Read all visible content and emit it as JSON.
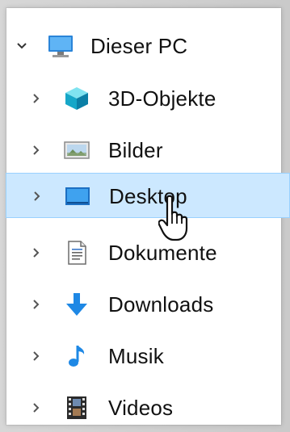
{
  "tree": {
    "root": {
      "label": "Dieser PC",
      "icon": "this-pc-icon",
      "expanded": true
    },
    "items": [
      {
        "label": "3D-Objekte",
        "icon": "3d-objects-icon"
      },
      {
        "label": "Bilder",
        "icon": "pictures-icon"
      },
      {
        "label": "Desktop",
        "icon": "desktop-icon",
        "selected": true
      },
      {
        "label": "Dokumente",
        "icon": "documents-icon"
      },
      {
        "label": "Downloads",
        "icon": "downloads-icon"
      },
      {
        "label": "Musik",
        "icon": "music-icon"
      },
      {
        "label": "Videos",
        "icon": "videos-icon"
      }
    ]
  },
  "colors": {
    "selection_background": "#cce8ff",
    "selection_border": "#99d1ff",
    "accent_blue": "#1e88e5"
  }
}
